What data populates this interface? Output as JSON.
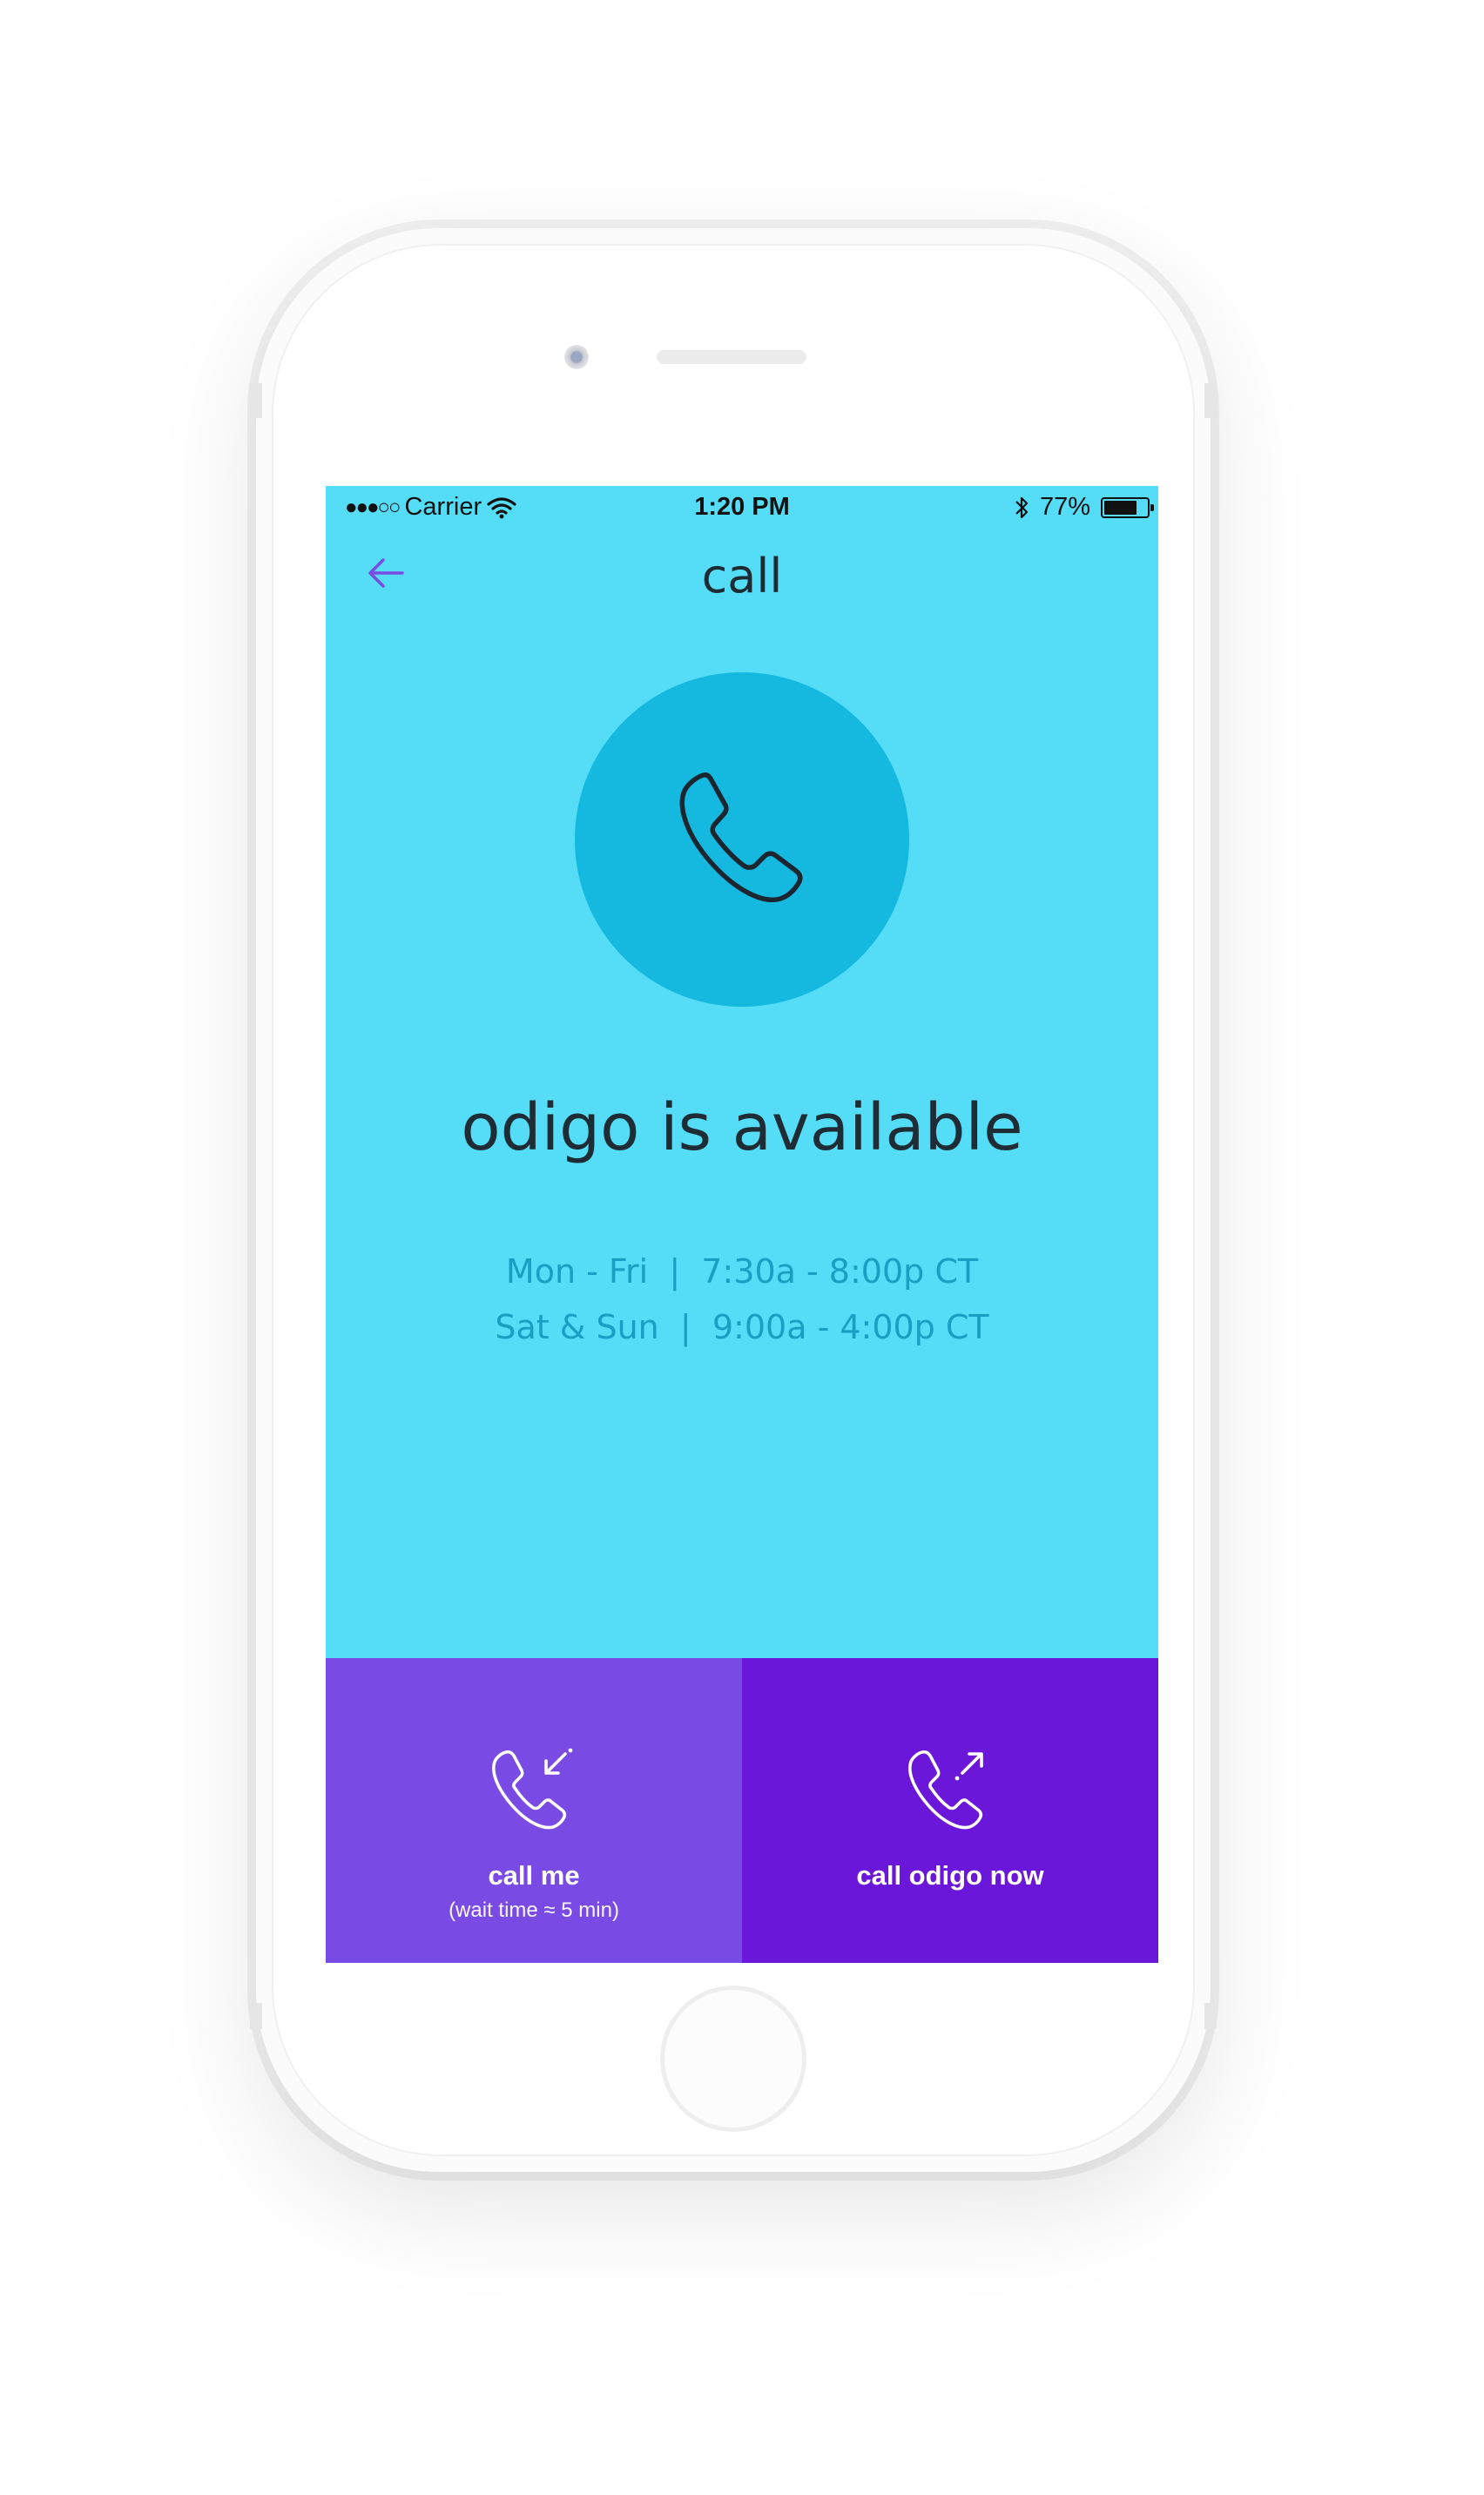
{
  "status_bar": {
    "signal": "●●●○○",
    "carrier": "Carrier",
    "time": "1:20 PM",
    "battery_text": "77%",
    "battery_level": 0.77
  },
  "nav": {
    "title": "call",
    "back_icon": "arrow-left-icon"
  },
  "main": {
    "hero_icon": "phone-icon",
    "headline": "odigo is available",
    "hours": [
      "Mon - Fri  |  7:30a - 8:00p CT",
      "Sat & Sun  |  9:00a - 4:00p CT"
    ]
  },
  "actions": {
    "call_me": {
      "label": "call me",
      "sublabel": "(wait time ≈ 5 min)",
      "icon": "phone-incoming-icon"
    },
    "call_now": {
      "label": "call odigo now",
      "icon": "phone-outgoing-icon"
    }
  },
  "colors": {
    "screen_background": "#55dcf6",
    "hero_circle": "#15b9df",
    "accent_purple": "#7a4ae4",
    "deep_purple": "#6a17da",
    "hours_text": "#1a9ec4"
  }
}
